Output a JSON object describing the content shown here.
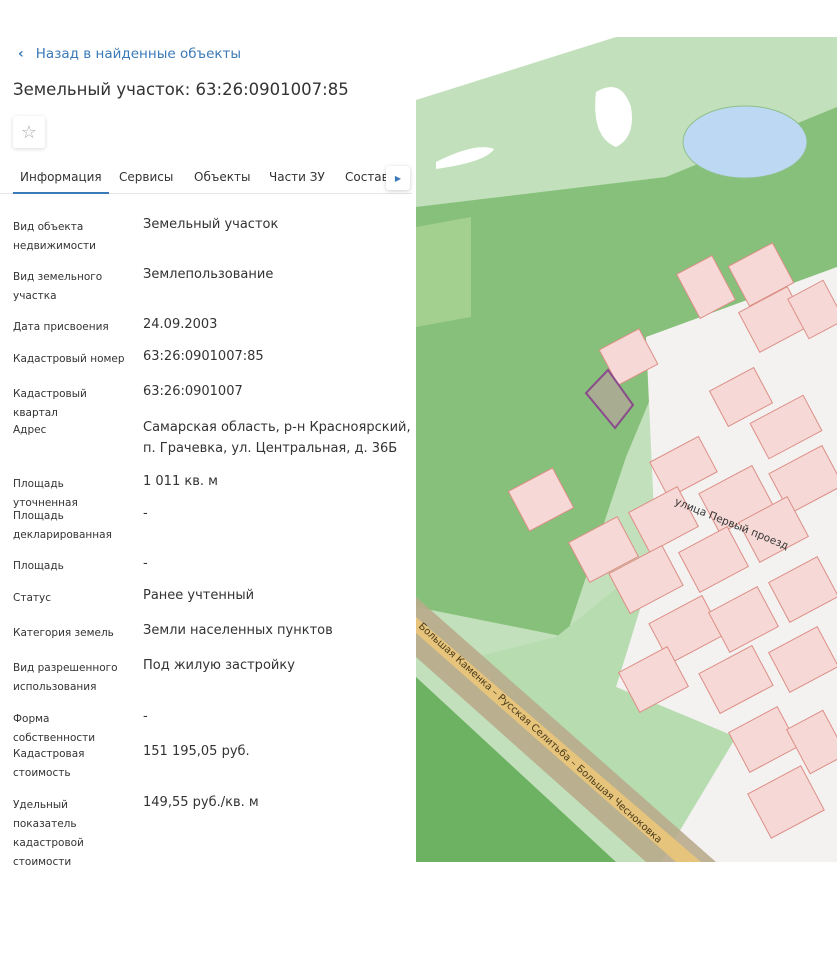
{
  "back_link": {
    "label": "Назад в найденные объекты",
    "icon": "chevron-left-icon"
  },
  "page_title": "Земельный участок: 63:26:0901007:85",
  "favorite_icon": "star-outline-icon",
  "tabs": [
    {
      "label": "Информация",
      "active": true
    },
    {
      "label": "Сервисы"
    },
    {
      "label": "Объекты"
    },
    {
      "label": "Части ЗУ"
    },
    {
      "label": "Состав"
    }
  ],
  "tabs_next_icon": "caret-right-icon",
  "fields": [
    {
      "label": "Вид объекта недвижимости",
      "value": "Земельный участок"
    },
    {
      "label": "Вид земельного участка",
      "value": "Землепользование"
    },
    {
      "label": "Дата присвоения",
      "value": "24.09.2003"
    },
    {
      "label": "Кадастровый номер",
      "value": "63:26:0901007:85"
    },
    {
      "label": "Кадастровый квартал",
      "value": "63:26:0901007"
    },
    {
      "label": "Адрес",
      "value": "Самарская область, р-н Красноярский, п. Грачевка, ул. Центральная, д. 36Б"
    },
    {
      "label": "Площадь уточненная",
      "value": "1 011 кв. м"
    },
    {
      "label": "Площадь декларированная",
      "value": "-"
    },
    {
      "label": "Площадь",
      "value": "-"
    },
    {
      "label": "Статус",
      "value": "Ранее учтенный"
    },
    {
      "label": "Категория земель",
      "value": "Земли населенных пунктов"
    },
    {
      "label": "Вид разрешенного использования",
      "value": "Под жилую застройку"
    },
    {
      "label": "Форма собственности",
      "value": "-"
    },
    {
      "label": "Кадастровая стоимость",
      "value": "151 195,05 руб."
    },
    {
      "label": "Удельный показатель кадастровой стоимости",
      "value": "149,55 руб./кв. м"
    }
  ],
  "map": {
    "street_labels": [
      "улица Первый проезд",
      "Большая Каменка – Русская Селитьба – Большая Чесноковка"
    ],
    "colors": {
      "forest_light": "#c2e0bb",
      "forest": "#86c07a",
      "forest_dark": "#6db262",
      "parcel": "#f6d9d6",
      "parcel_border": "#dc8f86",
      "selected": "#8a4c8c",
      "road": "#b9ab8c",
      "road_center": "#e6c47c",
      "water": "#bcd8f2"
    }
  }
}
